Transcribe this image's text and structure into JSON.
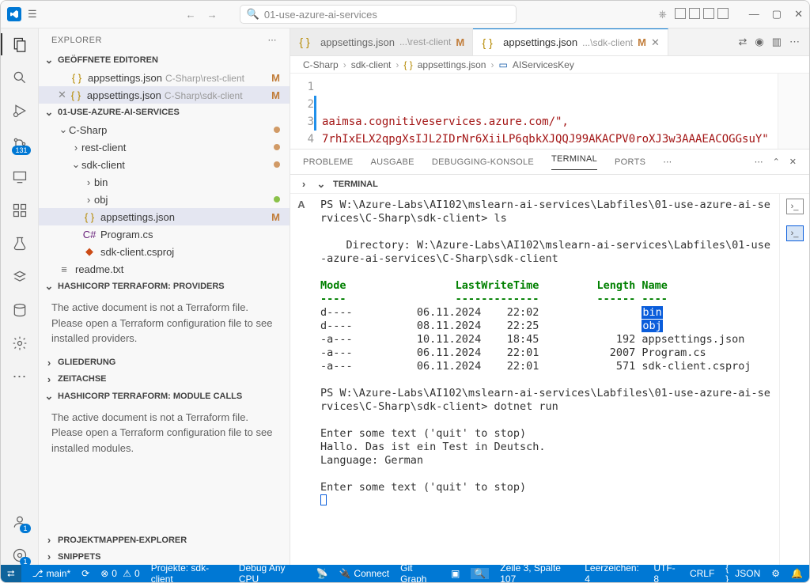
{
  "title_search": "01-use-azure-ai-services",
  "sidebar": {
    "title": "EXPLORER",
    "open_editors": "GEÖFFNETE EDITOREN",
    "editors": [
      {
        "name": "appsettings.json",
        "path": "C-Sharp\\rest-client",
        "status": "M"
      },
      {
        "name": "appsettings.json",
        "path": "C-Sharp\\sdk-client",
        "status": "M"
      }
    ],
    "workspace": "01-USE-AZURE-AI-SERVICES",
    "tree": {
      "csharp": "C-Sharp",
      "rest": "rest-client",
      "sdk": "sdk-client",
      "bin": "bin",
      "obj": "obj",
      "appsettings": "appsettings.json",
      "program": "Program.cs",
      "csproj": "sdk-client.csproj",
      "readme": "readme.txt"
    },
    "terraform_providers_h": "HASHICORP TERRAFORM: PROVIDERS",
    "terraform_providers_t": "The active document is not a Terraform file. Please open a Terraform configuration file to see installed providers.",
    "gliederung": "GLIEDERUNG",
    "zeitachse": "ZEITACHSE",
    "terraform_modules_h": "HASHICORP TERRAFORM: MODULE CALLS",
    "terraform_modules_t": "The active document is not a Terraform file. Please open a Terraform configuration file to see installed modules.",
    "projektmappen": "PROJEKTMAPPEN-EXPLORER",
    "snippets": "SNIPPETS"
  },
  "tabs": [
    {
      "name": "appsettings.json",
      "hint": "...\\rest-client",
      "status": "M"
    },
    {
      "name": "appsettings.json",
      "hint": "...\\sdk-client",
      "status": "M"
    }
  ],
  "breadcrumb": [
    "C-Sharp",
    "sdk-client",
    "appsettings.json",
    "AIServicesKey"
  ],
  "code": {
    "l2": "aaimsa.cognitiveservices.azure.com/\",",
    "l3": "7rhIxELX2qpgXsIJL2IDrNr6XiiLP6qbkXJQQJ99AKACPV0roXJ3w3AAAEACOGGsuY\""
  },
  "panel": {
    "tabs": [
      "PROBLEME",
      "AUSGABE",
      "DEBUGGING-KONSOLE",
      "TERMINAL",
      "PORTS"
    ],
    "subtitle": "TERMINAL"
  },
  "terminal": {
    "prompt1": "PS W:\\Azure-Labs\\AI102\\mslearn-ai-services\\Labfiles\\01-use-azure-ai-services\\C-Sharp\\sdk-client> ls",
    "dirline1": "    Directory: W:\\Azure-Labs\\AI102\\mslearn-ai-services\\Labfiles\\01-use-azure-ai-services\\C-Sharp\\sdk-client",
    "header": "Mode                 LastWriteTime         Length Name",
    "header2": "----                 -------------         ------ ----",
    "rows": [
      "d----          06.11.2024    22:02                ",
      "d----          08.11.2024    22:25                ",
      "-a---          10.11.2024    18:45            192 appsettings.json",
      "-a---          06.11.2024    22:01           2007 Program.cs",
      "-a---          06.11.2024    22:01            571 sdk-client.csproj"
    ],
    "sel1": "bin",
    "sel2": "obj",
    "prompt2": "PS W:\\Azure-Labs\\AI102\\mslearn-ai-services\\Labfiles\\01-use-azure-ai-services\\C-Sharp\\sdk-client> dotnet run",
    "out1": "Enter some text ('quit' to stop)",
    "out2": "Hallo. Das ist ein Test in Deutsch.",
    "out3": "Language: German",
    "out4": "Enter some text ('quit' to stop)"
  },
  "status": {
    "branch": "main*",
    "sync": "",
    "errors": "0",
    "warnings": "0",
    "projekte": "Projekte: sdk-client",
    "debug": "Debug Any CPU",
    "connect": "Connect",
    "gitgraph": "Git Graph",
    "pos": "Zeile 3, Spalte 107",
    "spaces": "Leerzeichen: 4",
    "enc": "UTF-8",
    "eol": "CRLF",
    "lang": "JSON"
  },
  "activity_badge": "131"
}
